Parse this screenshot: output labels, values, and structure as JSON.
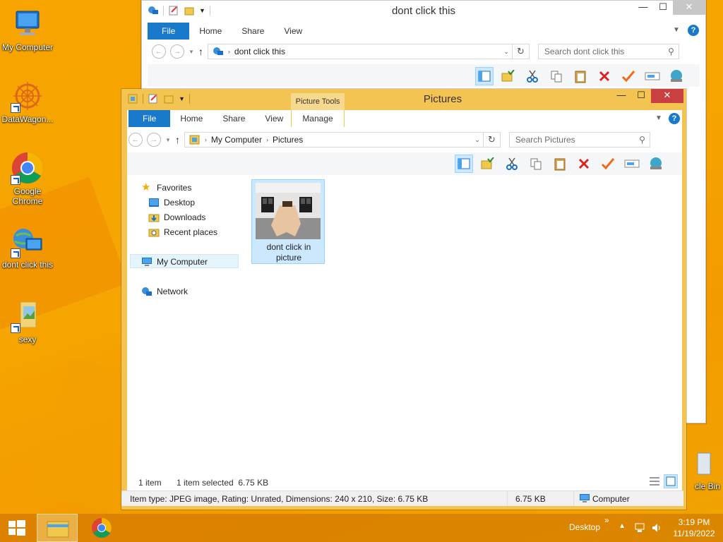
{
  "desktop": {
    "icons": [
      {
        "label": "My Computer"
      },
      {
        "label": "DataWagon..."
      },
      {
        "label": "Google Chrome"
      },
      {
        "label": "dont click this"
      },
      {
        "label": "sexy"
      },
      {
        "label": "cle Bin"
      }
    ]
  },
  "back_window": {
    "title": "dont click this",
    "tabs": [
      "File",
      "Home",
      "Share",
      "View"
    ],
    "address": "dont click this",
    "search_placeholder": "Search dont click this",
    "min": "—",
    "max": "☐",
    "close": "✕"
  },
  "front_window": {
    "title": "Pictures",
    "context_tab": "Picture Tools",
    "tabs": [
      "File",
      "Home",
      "Share",
      "View"
    ],
    "manage_tab": "Manage",
    "address": {
      "root": "My Computer",
      "current": "Pictures"
    },
    "search_placeholder": "Search Pictures",
    "min": "—",
    "max": "☐",
    "close": "✕",
    "nav": {
      "favorites": "Favorites",
      "desktop": "Desktop",
      "downloads": "Downloads",
      "recent": "Recent places",
      "computer": "My Computer",
      "network": "Network"
    },
    "file": {
      "name_line1": "dont click in",
      "name_line2": "picture"
    },
    "status": {
      "count": "1 item",
      "selected": "1 item selected  6.75 KB"
    },
    "info": {
      "details": "Item type: JPEG image, Rating: Unrated, Dimensions: 240 x 210, Size: 6.75 KB",
      "size": "6.75 KB",
      "location": "Computer"
    }
  },
  "taskbar": {
    "desktop_label": "Desktop",
    "time": "3:19 PM",
    "date": "11/19/2022",
    "chevron": "»"
  },
  "colors": {
    "desktop": "#f6a400",
    "front_frame": "#f4c452",
    "file_tab": "#1979ca",
    "close_button": "#c94040",
    "selection": "#cce8ff"
  }
}
